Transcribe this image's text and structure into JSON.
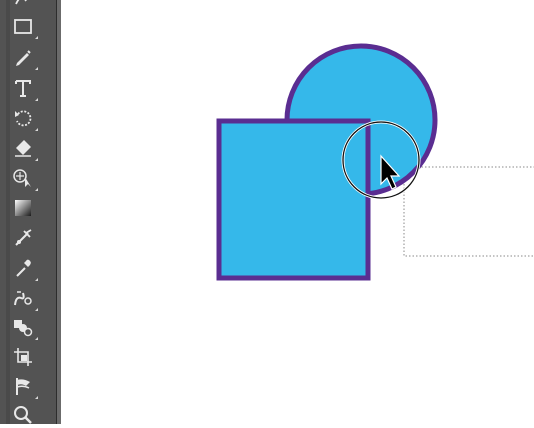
{
  "app": {
    "colors": {
      "toolbar_bg": "#535353",
      "shape_fill": "#35b8ea",
      "shape_stroke": "#5a2d91",
      "icon": "#e8e8e8"
    }
  },
  "toolbar": {
    "tools": [
      {
        "name": "shaper-icon",
        "has_submenu": false
      },
      {
        "name": "rectangle-tool-icon",
        "has_submenu": true
      },
      {
        "name": "pencil-tool-icon",
        "has_submenu": true
      },
      {
        "name": "type-tool-icon",
        "has_submenu": true
      },
      {
        "name": "rotate-tool-icon",
        "has_submenu": true
      },
      {
        "name": "eraser-tool-icon",
        "has_submenu": true
      },
      {
        "name": "shape-builder-tool-icon",
        "has_submenu": true
      },
      {
        "name": "gradient-tool-icon",
        "has_submenu": false
      },
      {
        "name": "mesh-tool-icon",
        "has_submenu": false
      },
      {
        "name": "eyedropper-tool-icon",
        "has_submenu": true
      },
      {
        "name": "blend-tool-icon",
        "has_submenu": true
      },
      {
        "name": "symbol-sprayer-tool-icon",
        "has_submenu": true
      },
      {
        "name": "artboard-tool-icon",
        "has_submenu": false
      },
      {
        "name": "slice-tool-icon",
        "has_submenu": true
      },
      {
        "name": "zoom-tool-icon",
        "has_submenu": false
      }
    ]
  },
  "canvas": {
    "shapes": [
      {
        "type": "circle",
        "name": "circle-shape"
      },
      {
        "type": "rectangle",
        "name": "square-shape"
      }
    ],
    "cursor": "shape-builder-cursor-icon",
    "selection_marquee": "dotted-selection-marquee"
  }
}
